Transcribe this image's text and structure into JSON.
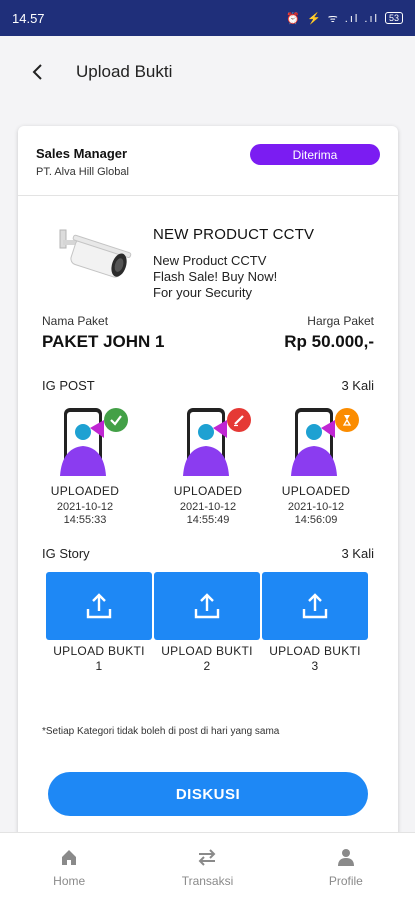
{
  "status_bar": {
    "time": "14.57",
    "indicators": "⏰ ⚡ ᯤ .ıl .ıl",
    "battery": "53"
  },
  "app_bar": {
    "title": "Upload Bukti"
  },
  "company": {
    "role": "Sales Manager",
    "name": "PT. Alva Hill Global",
    "status": "Diterima",
    "status_color": "#7b1cf2"
  },
  "product": {
    "title": "NEW PRODUCT CCTV",
    "desc_lines": [
      "New Product CCTV",
      "Flash Sale! Buy Now!",
      "For your Security"
    ]
  },
  "paket": {
    "name_label": "Nama Paket",
    "name": "PAKET JOHN 1",
    "price_label": "Harga Paket",
    "price": "Rp 50.000,-"
  },
  "ig_post": {
    "title": "IG POST",
    "count": "3 Kali",
    "items": [
      {
        "status": "UPLOADED",
        "date": "2021-10-12",
        "time": "14:55:33",
        "badge_icon": "check-icon",
        "badge_color": "#43a047"
      },
      {
        "status": "UPLOADED",
        "date": "2021-10-12",
        "time": "14:55:49",
        "badge_icon": "pencil-icon",
        "badge_color": "#e53935"
      },
      {
        "status": "UPLOADED",
        "date": "2021-10-12",
        "time": "14:56:09",
        "badge_icon": "hourglass-icon",
        "badge_color": "#fb8c00"
      }
    ]
  },
  "ig_story": {
    "title": "IG Story",
    "count": "3 Kali",
    "items": [
      {
        "label_line1": "UPLOAD BUKTI",
        "label_line2": "1"
      },
      {
        "label_line1": "UPLOAD BUKTI",
        "label_line2": "2"
      },
      {
        "label_line1": "UPLOAD BUKTI",
        "label_line2": "3"
      }
    ]
  },
  "note": "*Setiap Kategori tidak boleh di post di hari yang sama",
  "diskusi_label": "DISKUSI",
  "accent_color": "#1e88f5",
  "nav": [
    {
      "label": "Home",
      "icon": "home-icon"
    },
    {
      "label": "Transaksi",
      "icon": "transfer-icon"
    },
    {
      "label": "Profile",
      "icon": "person-icon"
    }
  ]
}
